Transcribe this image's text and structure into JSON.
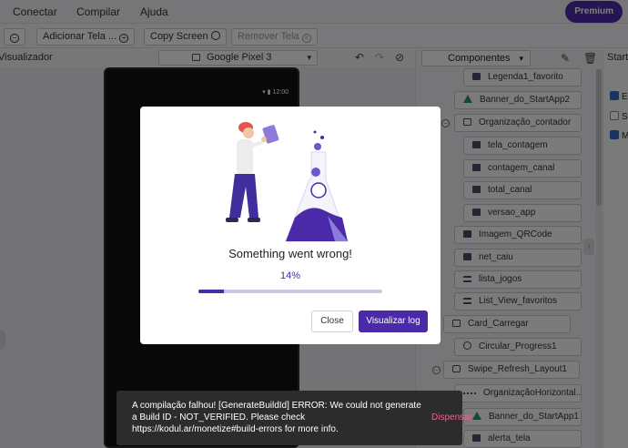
{
  "menu": {
    "items": [
      "Conectar",
      "Compilar",
      "Ajuda"
    ],
    "premium_label": "Premium"
  },
  "toolbar": {
    "collapse_icon": "minus-circle-icon",
    "add_screen_label": "Adicionar Tela ...",
    "copy_screen_label": "Copy Screen",
    "remove_screen_label": "Remover Tela"
  },
  "viewer": {
    "title": "Visualizador",
    "device": "Google Pixel 3",
    "status_time": "12:00"
  },
  "components": {
    "title": "Componentes",
    "items": [
      {
        "label": "Legenda1_favorito",
        "icon": "image-icon"
      },
      {
        "label": "Banner_do_StartApp2",
        "icon": "startapp-icon"
      },
      {
        "label": "Organização_contador",
        "icon": "arrangement-icon"
      },
      {
        "label": "tela_contagem",
        "icon": "label-icon"
      },
      {
        "label": "contagem_canal",
        "icon": "label-icon"
      },
      {
        "label": "total_canal",
        "icon": "label-icon"
      },
      {
        "label": "versao_app",
        "icon": "label-icon"
      },
      {
        "label": "Imagem_QRCode",
        "icon": "image-icon"
      },
      {
        "label": "net_caiu",
        "icon": "image-icon"
      },
      {
        "label": "lista_jogos",
        "icon": "list-icon"
      },
      {
        "label": "List_View_favoritos",
        "icon": "list-icon"
      },
      {
        "label": "Card_Carregar",
        "icon": "card-icon"
      },
      {
        "label": "Circular_Progress1",
        "icon": "progress-icon"
      },
      {
        "label": "Swipe_Refresh_Layout1",
        "icon": "swipe-icon"
      },
      {
        "label": "OrganizaçãoHorizontal...",
        "icon": "horizontal-icon"
      },
      {
        "label": "Banner_do_StartApp1",
        "icon": "startapp-icon"
      },
      {
        "label": "alerta_tela",
        "icon": "image-icon"
      }
    ]
  },
  "properties": {
    "title": "Start...",
    "rows": [
      {
        "label": "E",
        "checked": true
      },
      {
        "label": "S",
        "checked": false
      },
      {
        "label": "M",
        "checked": true
      }
    ]
  },
  "dialog": {
    "message": "Something went wrong!",
    "progress_text": "14%",
    "progress": 0.14,
    "close_label": "Close",
    "log_label": "Visualizar log"
  },
  "toast": {
    "message": "A compilação falhou! [GenerateBuildId] ERROR: We could not generate a Build ID - NOT_VERIFIED. Please check https://kodul.ar/monetize#build-errors for more info.",
    "action": "Dispensar"
  },
  "colors": {
    "accent": "#4a2aa8",
    "toast_action": "#f06292"
  }
}
